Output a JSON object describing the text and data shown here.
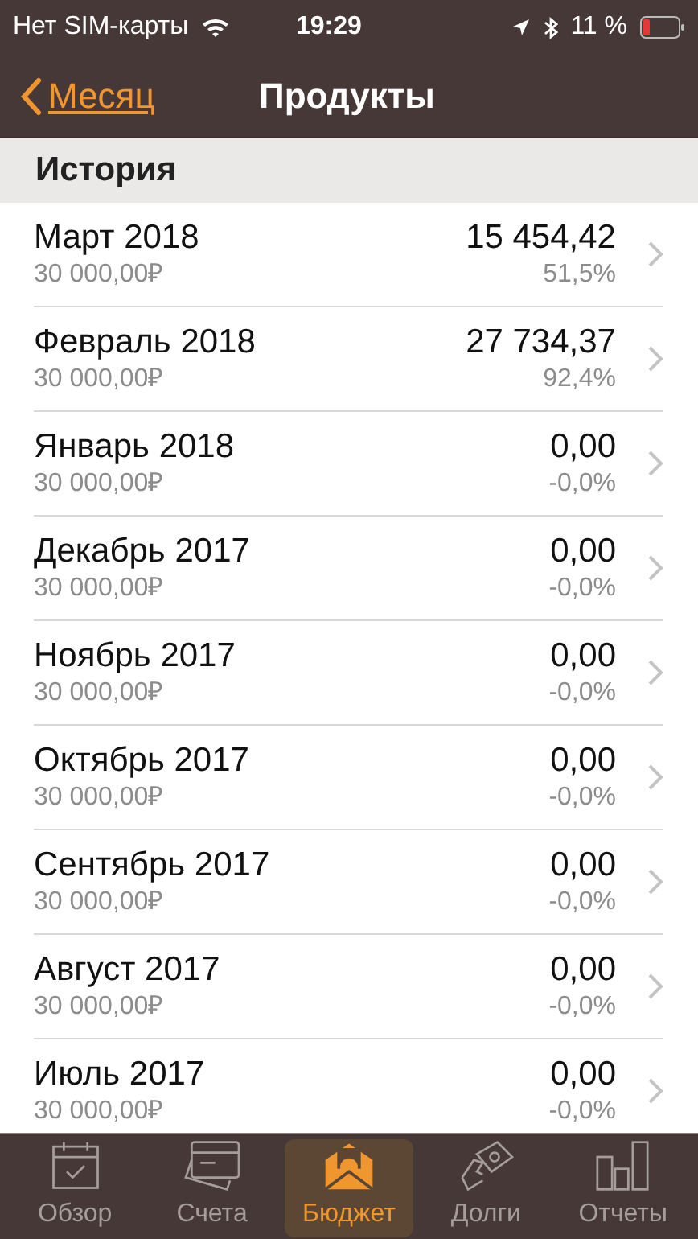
{
  "status_bar": {
    "carrier": "Нет SIM-карты",
    "time": "19:29",
    "battery": "11 %"
  },
  "nav": {
    "back": "Месяц",
    "title": "Продукты"
  },
  "section": "История",
  "rows": [
    {
      "month": "Март 2018",
      "budget": "30 000,00₽",
      "amount": "15 454,42",
      "percent": "51,5%"
    },
    {
      "month": "Февраль 2018",
      "budget": "30 000,00₽",
      "amount": "27 734,37",
      "percent": "92,4%"
    },
    {
      "month": "Январь 2018",
      "budget": "30 000,00₽",
      "amount": "0,00",
      "percent": "-0,0%"
    },
    {
      "month": "Декабрь 2017",
      "budget": "30 000,00₽",
      "amount": "0,00",
      "percent": "-0,0%"
    },
    {
      "month": "Ноябрь 2017",
      "budget": "30 000,00₽",
      "amount": "0,00",
      "percent": "-0,0%"
    },
    {
      "month": "Октябрь 2017",
      "budget": "30 000,00₽",
      "amount": "0,00",
      "percent": "-0,0%"
    },
    {
      "month": "Сентябрь 2017",
      "budget": "30 000,00₽",
      "amount": "0,00",
      "percent": "-0,0%"
    },
    {
      "month": "Август 2017",
      "budget": "30 000,00₽",
      "amount": "0,00",
      "percent": "-0,0%"
    },
    {
      "month": "Июль 2017",
      "budget": "30 000,00₽",
      "amount": "0,00",
      "percent": "-0,0%"
    }
  ],
  "tabs": [
    {
      "label": "Обзор",
      "kind": "calendar",
      "selected": false
    },
    {
      "label": "Счета",
      "kind": "cards",
      "selected": false
    },
    {
      "label": "Бюджет",
      "kind": "envelope",
      "selected": true
    },
    {
      "label": "Долги",
      "kind": "hand",
      "selected": false
    },
    {
      "label": "Отчеты",
      "kind": "bars",
      "selected": false
    }
  ]
}
